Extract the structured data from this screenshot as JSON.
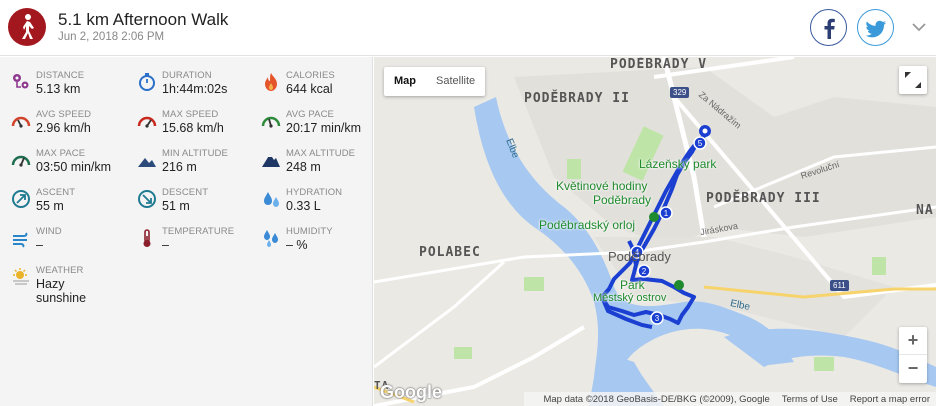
{
  "activity": {
    "title": "5.1 km Afternoon Walk",
    "datetime": "Jun 2, 2018 2:06 PM",
    "icon": "walking-person-icon",
    "accent": "#a3181e"
  },
  "share": {
    "facebook_icon": "facebook-icon",
    "twitter_icon": "twitter-icon"
  },
  "stats": [
    {
      "key": "distance",
      "label": "Distance",
      "value": "5.13 km",
      "icon": "route-pin-icon",
      "color": "#8e3a8e"
    },
    {
      "key": "duration",
      "label": "Duration",
      "value": "1h:44m:02s",
      "icon": "stopwatch-icon",
      "color": "#2a6fc9"
    },
    {
      "key": "calories",
      "label": "Calories",
      "value": "644 kcal",
      "icon": "flame-icon",
      "color": "#e5552b"
    },
    {
      "key": "avg_speed",
      "label": "Avg Speed",
      "value": "2.96 km/h",
      "icon": "speedometer-icon",
      "color": "#d2432b"
    },
    {
      "key": "max_speed",
      "label": "Max Speed",
      "value": "15.68 km/h",
      "icon": "speedometer-icon",
      "color": "#c8291f"
    },
    {
      "key": "avg_pace",
      "label": "Avg Pace",
      "value": "20:17 min/km",
      "icon": "pace-gauge-icon",
      "color": "#2e8b3c"
    },
    {
      "key": "max_pace",
      "label": "Max Pace",
      "value": "03:50 min/km",
      "icon": "pace-gauge-icon",
      "color": "#1f6e4f"
    },
    {
      "key": "min_altitude",
      "label": "Min Altitude",
      "value": "216 m",
      "icon": "mountain-low-icon",
      "color": "#2c4a7a"
    },
    {
      "key": "max_altitude",
      "label": "Max Altitude",
      "value": "248 m",
      "icon": "mountain-high-icon",
      "color": "#1e3764"
    },
    {
      "key": "ascent",
      "label": "Ascent",
      "value": "55 m",
      "icon": "ascent-icon",
      "color": "#1f7a92"
    },
    {
      "key": "descent",
      "label": "Descent",
      "value": "51 m",
      "icon": "descent-icon",
      "color": "#1f7a92"
    },
    {
      "key": "hydration",
      "label": "Hydration",
      "value": "0.33 L",
      "icon": "water-drops-icon",
      "color": "#3a8ad6"
    },
    {
      "key": "wind",
      "label": "Wind",
      "value": "–",
      "icon": "wind-icon",
      "color": "#2a86c9"
    },
    {
      "key": "temperature",
      "label": "Temperature",
      "value": "–",
      "icon": "thermometer-icon",
      "color": "#8a1e2a"
    },
    {
      "key": "humidity",
      "label": "Humidity",
      "value": "– %",
      "icon": "humidity-drops-icon",
      "color": "#3a8ad6"
    },
    {
      "key": "weather",
      "label": "Weather",
      "value": "Hazy sunshine",
      "icon": "sun-haze-icon",
      "color": "#e9b42a"
    }
  ],
  "map": {
    "type_buttons": [
      "Map",
      "Satellite"
    ],
    "active_type": "Map",
    "zoom_in": "+",
    "zoom_out": "−",
    "route_color": "#1a3fd1",
    "labels": {
      "district1": "PODĚBRADY V",
      "district2": "PODĚBRADY II",
      "district3": "PODĚBRADY III",
      "district4": "POLABEC",
      "district5": "Poděbrady",
      "district_edge": "NA",
      "park1": "Lázeňský park",
      "poi1a": "Květinové hodiny",
      "poi1b": "Poděbrady",
      "poi2": "Poděbradský orloj",
      "park2": "Park",
      "island": "Městský ostrov",
      "street1": "Za Nádražím",
      "street2": "Revoluční",
      "street3": "Jiráskova",
      "river1": "Elbe",
      "river2": "Elbe",
      "road1": "329",
      "road2": "611",
      "edge_text": "TA"
    },
    "markers": [
      "5",
      "1",
      "2",
      "3",
      "4"
    ],
    "google": "Google",
    "attribution": "Map data ©2018 GeoBasis-DE/BKG (©2009), Google",
    "terms": "Terms of Use",
    "report": "Report a map error"
  }
}
